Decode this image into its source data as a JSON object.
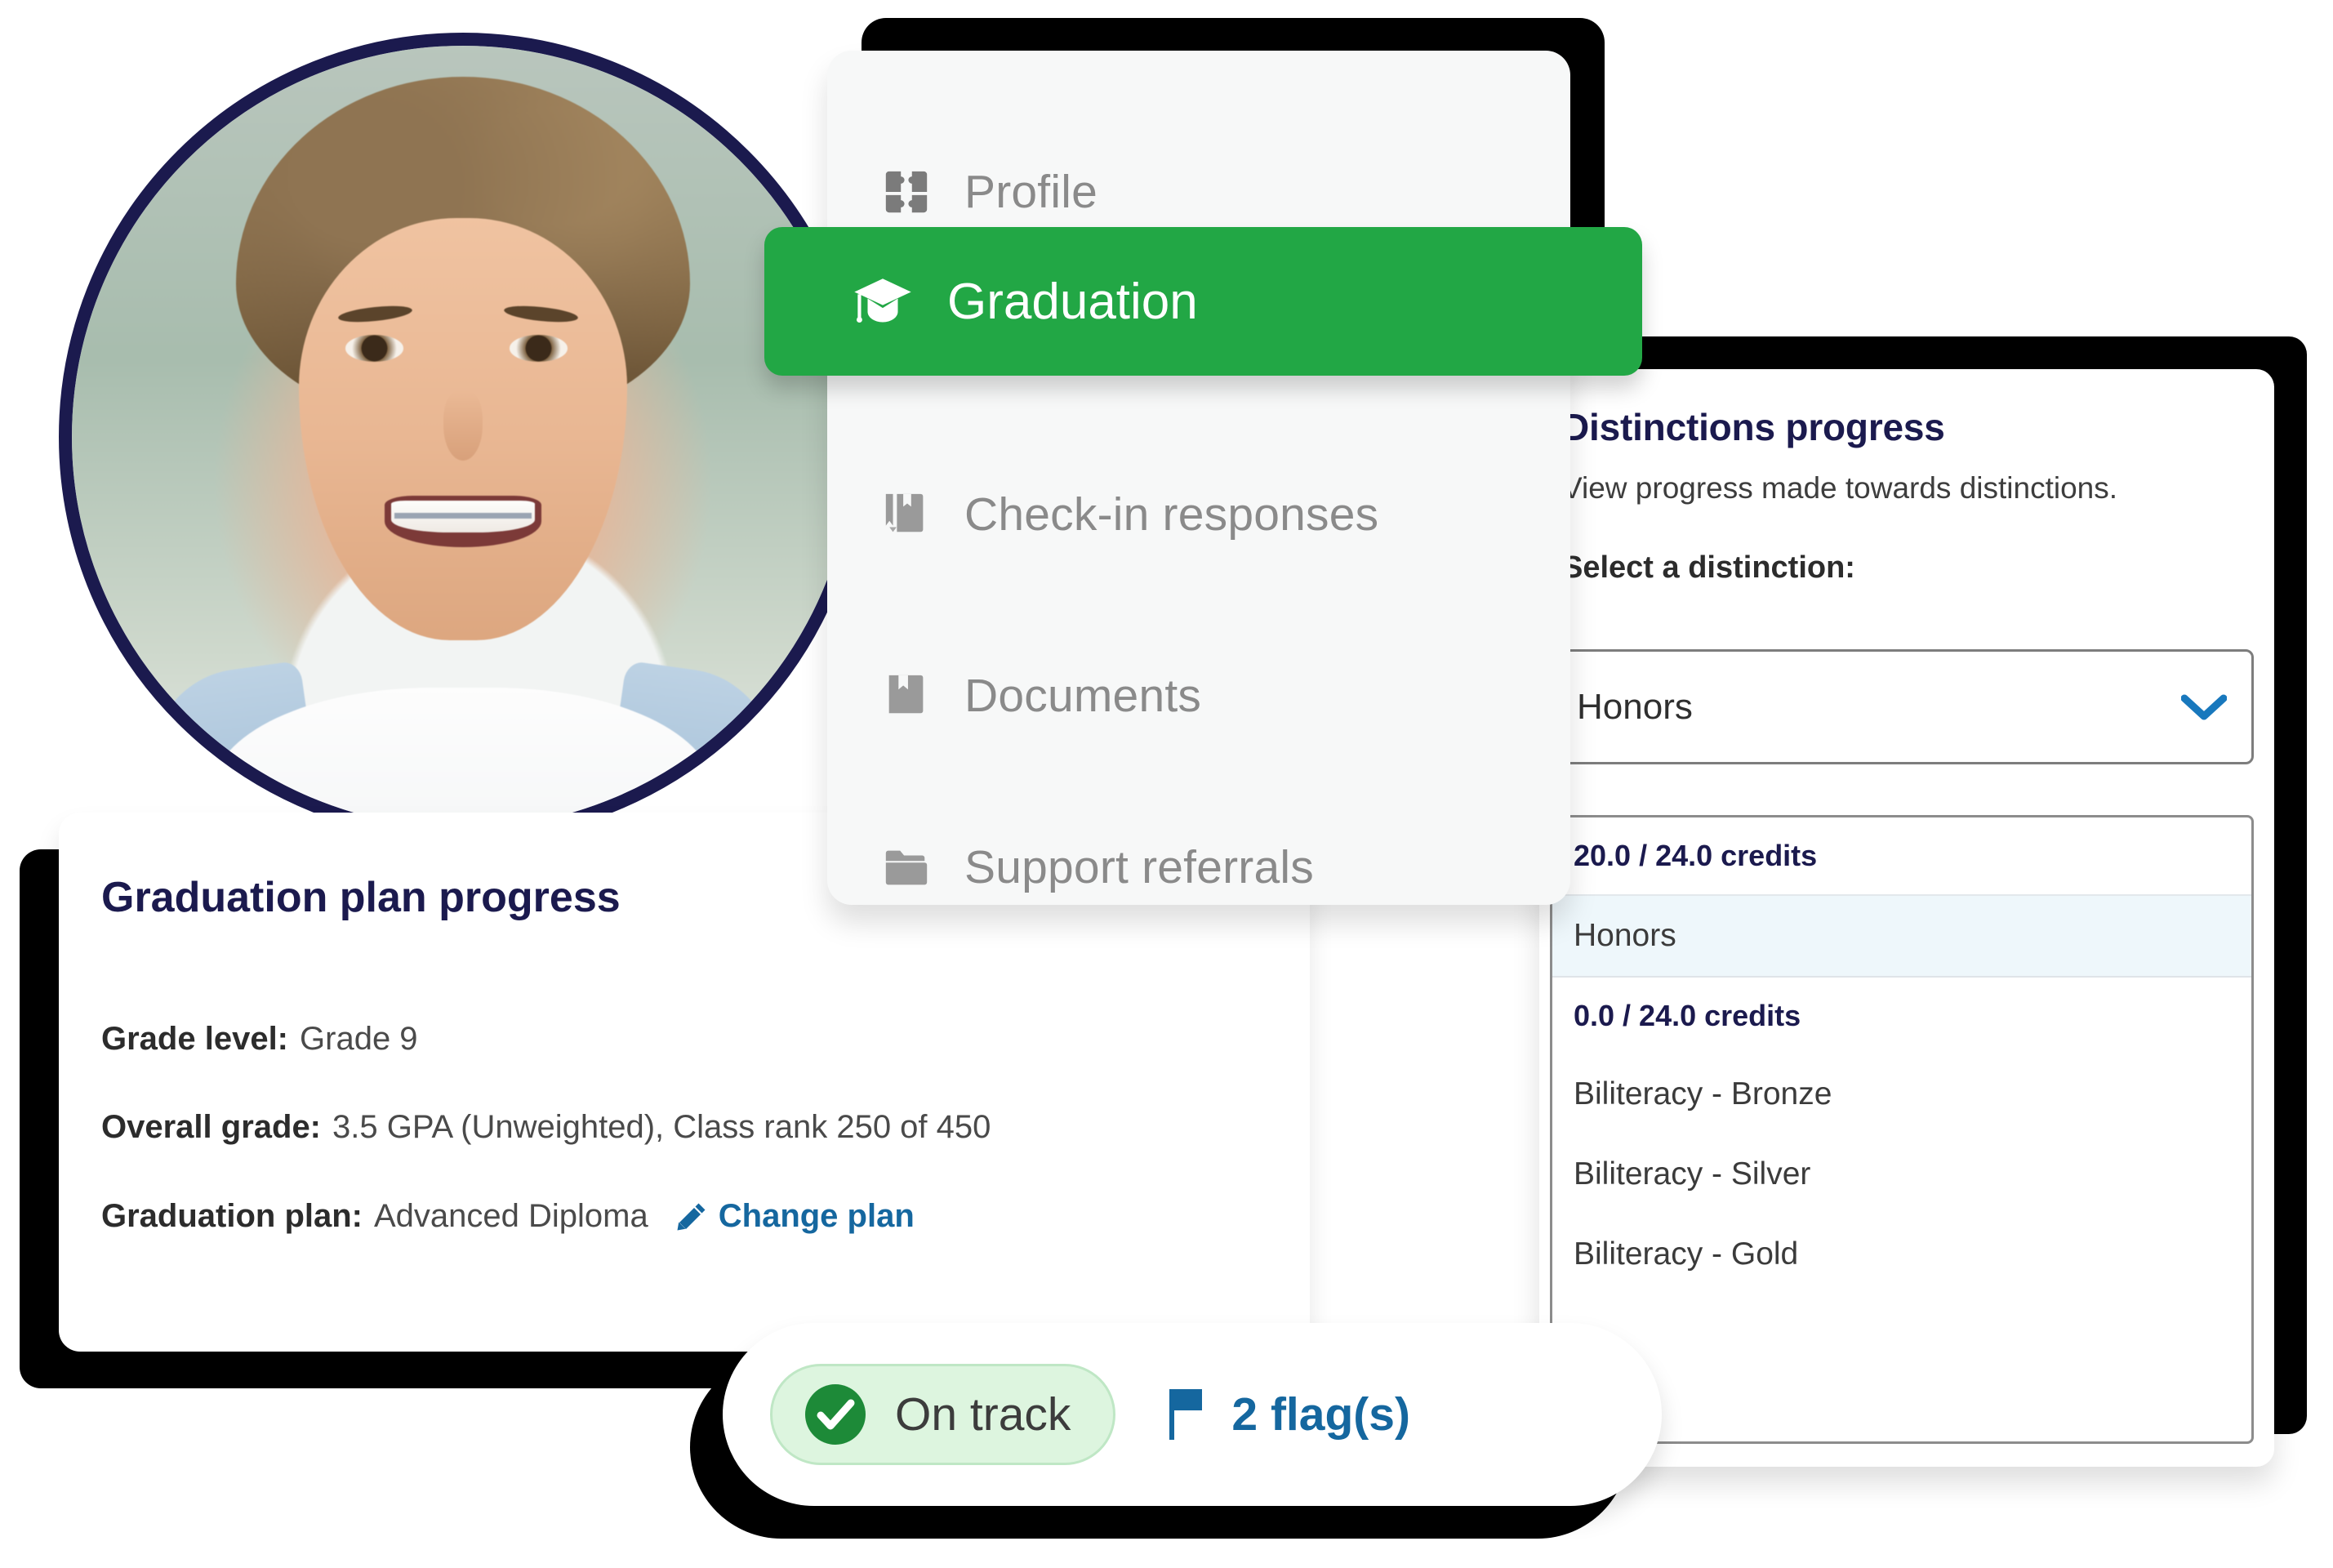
{
  "avatar": {
    "alt": "student-photo"
  },
  "menu": {
    "items": [
      {
        "label": "Profile",
        "icon": "puzzle-icon",
        "active": false
      },
      {
        "label": "Graduation",
        "icon": "graduation-cap-icon",
        "active": true
      },
      {
        "label": "Check-in responses",
        "icon": "book-pencil-icon",
        "active": false
      },
      {
        "label": "Documents",
        "icon": "book-icon",
        "active": false
      },
      {
        "label": "Support referrals",
        "icon": "folder-icon",
        "active": false
      }
    ],
    "active_color": "#22a745"
  },
  "distinctions": {
    "title": "Distinctions progress",
    "subtitle": "View progress made towards distinctions.",
    "select_label": "Select a distinction:",
    "selected_value": "Honors",
    "chevron_color": "#1878bd",
    "listbox": [
      {
        "type": "group",
        "label": "20.0 / 24.0 credits"
      },
      {
        "type": "option",
        "label": "Honors",
        "selected": true
      },
      {
        "type": "group",
        "label": "0.0 / 24.0 credits"
      },
      {
        "type": "option",
        "label": "Biliteracy - Bronze",
        "selected": false
      },
      {
        "type": "option",
        "label": "Biliteracy - Silver",
        "selected": false
      },
      {
        "type": "option",
        "label": "Biliteracy - Gold",
        "selected": false
      }
    ]
  },
  "plan": {
    "title": "Graduation plan progress",
    "grade_level_label": "Grade level:",
    "grade_level_value": "Grade 9",
    "overall_grade_label": "Overall grade:",
    "overall_grade_value": "3.5 GPA (Unweighted), Class rank 250 of 450",
    "graduation_plan_label": "Graduation plan:",
    "graduation_plan_value": "Advanced Diploma",
    "change_plan_label": "Change plan"
  },
  "status": {
    "on_track_label": "On track",
    "on_track_color": "#1d8a38",
    "flags_label": "2 flag(s)",
    "flags_color": "#15679f"
  }
}
